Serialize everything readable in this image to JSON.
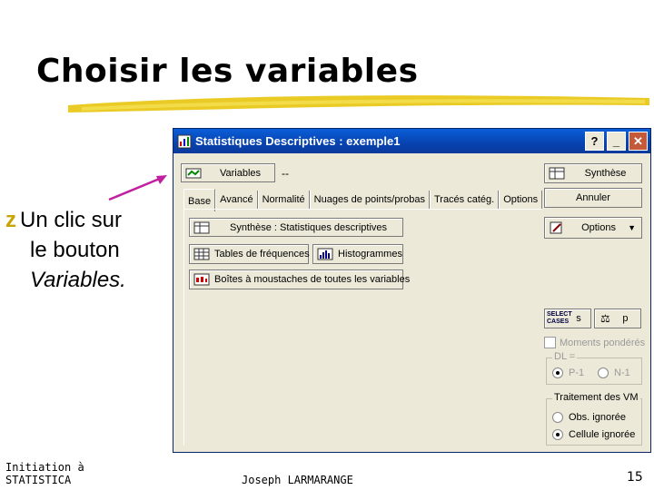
{
  "slide": {
    "title": "Choisir les variables",
    "bullet_line1": "Un clic sur",
    "bullet_line2": "le bouton",
    "bullet_line3": "Variables.",
    "bullet_marker": "z",
    "footer_left_line1": "Initiation à",
    "footer_left_line2": "STATISTICA",
    "footer_center": "Joseph LARMARANGE",
    "page_number": "15",
    "accent_color": "#e6c200"
  },
  "window": {
    "title": "Statistiques Descriptives : exemple1",
    "help_glyph": "?",
    "minimize_glyph": "_",
    "close_glyph": "✕",
    "variables_label": "Variables",
    "variables_value": "--",
    "synthese_label": "Synthèse",
    "annuler_label": "Annuler",
    "options_label": "Options",
    "tabs": [
      "Base",
      "Avancé",
      "Normalité",
      "Nuages de points/probas",
      "Tracés catég.",
      "Options"
    ],
    "buttons": {
      "synthese_stats": "Synthèse : Statistiques descriptives",
      "tables_freq": "Tables de fréquences",
      "histogrammes": "Histogrammes",
      "boites": "Boîtes à moustaches de toutes les variables"
    },
    "select_cases_label": "SELECT CASES",
    "s_label": "s",
    "p_label": "p",
    "moments_label": "Moments pondérés",
    "dl_group_label": "DL =",
    "dl_options": [
      "P-1",
      "N-1"
    ],
    "vm_group_label": "Traitement des VM",
    "vm_options": [
      "Obs. ignorée",
      "Cellule ignorée"
    ]
  }
}
